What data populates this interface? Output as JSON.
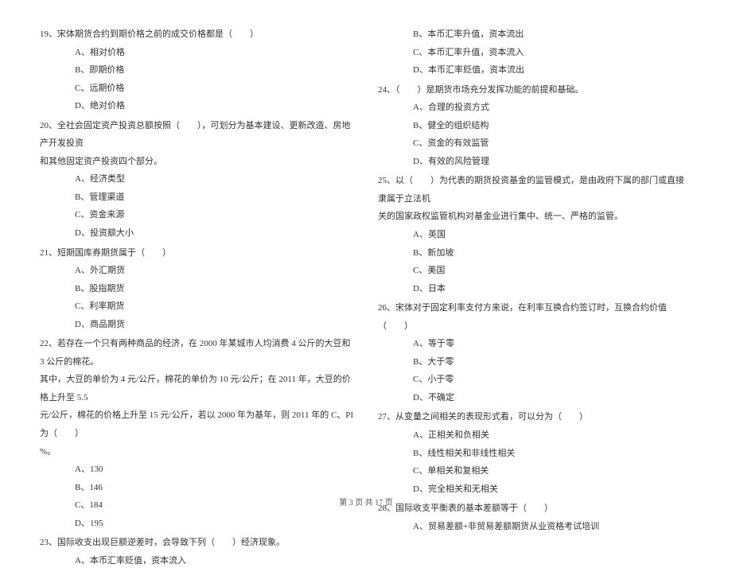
{
  "left": {
    "q19": {
      "text": "19、宋体期货合约到期价格之前的成交价格都是（　　）",
      "a": "A、相对价格",
      "b": "B、即期价格",
      "c": "C、远期价格",
      "d": "D、绝对价格"
    },
    "q20": {
      "text": "20、全社会固定资产投资总额按照（　　），可划分为基本建设、更新改造、房地产开发投资",
      "text2": "和其他固定资产投资四个部分。",
      "a": "A、经济类型",
      "b": "B、管理渠道",
      "c": "C、资金来源",
      "d": "D、投资额大小"
    },
    "q21": {
      "text": "21、短期国库券期货属于（　　）",
      "a": "A、外汇期货",
      "b": "B、股指期货",
      "c": "C、利率期货",
      "d": "D、商品期货"
    },
    "q22": {
      "text": "22、若存在一个只有两种商品的经济，在 2000 年某城市人均消费 4 公斤的大豆和 3 公斤的棉花。",
      "text2": "其中，大豆的单价为 4 元/公斤，棉花的单价为 10 元/公斤；在 2011 年，大豆的价格上升至 5.5",
      "text3": "元/公斤，棉花的价格上升至 15 元/公斤，若以 2000 年为基年，则 2011 年的 C、PI 为（　　）",
      "text4": "%。",
      "a": "A、130",
      "b": "B、146",
      "c": "C、184",
      "d": "D、195"
    },
    "q23": {
      "text": "23、国际收支出现巨额逆差时，会导致下列（　　）经济现象。",
      "a": "A、本币汇率贬值，资本流入"
    }
  },
  "right": {
    "q23_cont": {
      "b": "B、本币汇率升值，资本流出",
      "c": "C、本币汇率升值，资本流入",
      "d": "D、本币汇率贬值，资本流出"
    },
    "q24": {
      "text": "24、（　　）是期货市场充分发挥功能的前提和基础。",
      "a": "A、合理的投资方式",
      "b": "B、健全的组织结构",
      "c": "C、资金的有效监管",
      "d": "D、有效的风险管理"
    },
    "q25": {
      "text": "25、以（　　）为代表的期货投资基金的监管模式，是由政府下属的部门或直接隶属于立法机",
      "text2": "关的国家政权监管机构对基金业进行集中、统一、严格的监管。",
      "a": "A、英国",
      "b": "B、新加坡",
      "c": "C、美国",
      "d": "D、日本"
    },
    "q26": {
      "text": "26、宋体对于固定利率支付方来说，在利率互换合约签订时，互换合约价值（　　）",
      "a": "A、等于零",
      "b": "B、大于零",
      "c": "C、小于零",
      "d": "D、不确定"
    },
    "q27": {
      "text": "27、从变量之间相关的表现形式看，可以分为（　　）",
      "a": "A、正相关和负相关",
      "b": "B、线性相关和非线性相关",
      "c": "C、单相关和复相关",
      "d": "D、完全相关和无相关"
    },
    "q28": {
      "text": "28、国际收支平衡表的基本差额等于（　　）",
      "a": "A、贸易差额+非贸易差额期货从业资格考试培训"
    }
  },
  "footer": "第 3 页 共 17 页"
}
